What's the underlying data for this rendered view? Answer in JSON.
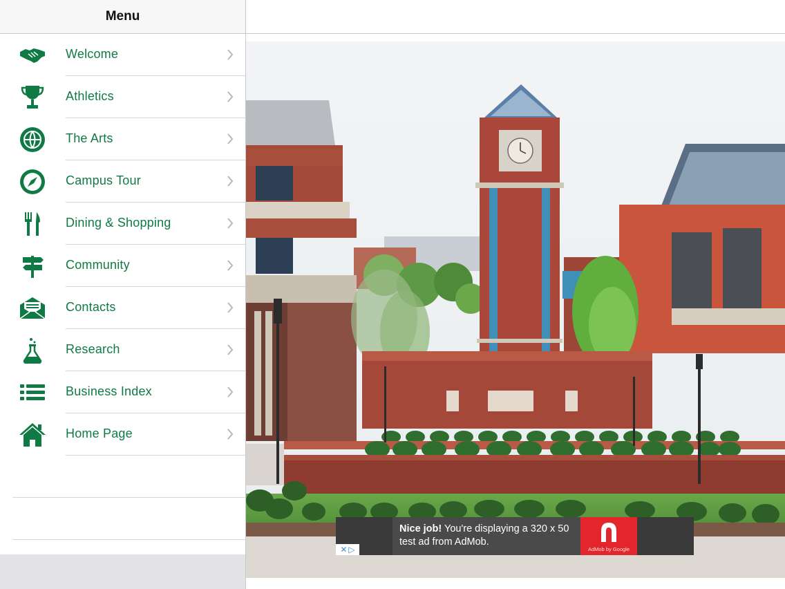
{
  "sidebar": {
    "title": "Menu",
    "items": [
      {
        "label": "Welcome",
        "icon": "handshake-icon"
      },
      {
        "label": "Athletics",
        "icon": "trophy-icon"
      },
      {
        "label": "The Arts",
        "icon": "globe-icon"
      },
      {
        "label": "Campus Tour",
        "icon": "compass-icon"
      },
      {
        "label": "Dining & Shopping",
        "icon": "fork-knife-icon"
      },
      {
        "label": "Community",
        "icon": "signpost-icon"
      },
      {
        "label": "Contacts",
        "icon": "envelope-icon"
      },
      {
        "label": "Research",
        "icon": "flask-icon"
      },
      {
        "label": "Business Index",
        "icon": "list-icon"
      },
      {
        "label": "Home Page",
        "icon": "home-icon"
      }
    ]
  },
  "ad": {
    "bold": "Nice job!",
    "line1": " You're displaying a 320 x 50",
    "line2": "test ad from AdMob.",
    "logo_caption": "AdMob by Google",
    "choices_close": "✕",
    "choices_play": "▷"
  },
  "colors": {
    "accent": "#0f7a43",
    "ad_red": "#e3262e",
    "separator": "#d6d6d6"
  }
}
